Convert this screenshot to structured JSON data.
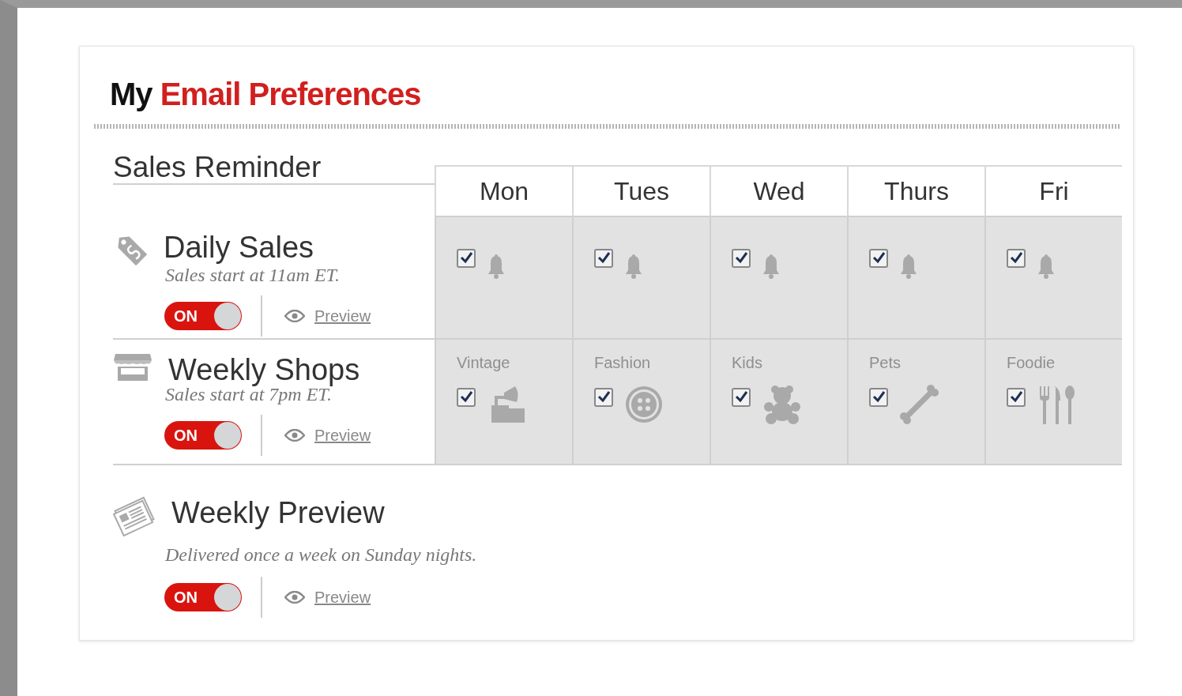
{
  "title": {
    "prefix": "My",
    "highlight": "Email Preferences"
  },
  "section_title": "Sales Reminder",
  "days": [
    {
      "label": "Mon"
    },
    {
      "label": "Tues"
    },
    {
      "label": "Wed"
    },
    {
      "label": "Thurs"
    },
    {
      "label": "Fri"
    }
  ],
  "reminders": [
    {
      "kind": "tag",
      "name": "Daily Sales",
      "note": "Sales start at 11am ET.",
      "toggle": {
        "label": "ON",
        "on": true
      },
      "preview": "Preview",
      "cells": [
        {
          "checked": true,
          "kind": "bell"
        },
        {
          "checked": true,
          "kind": "bell"
        },
        {
          "checked": true,
          "kind": "bell"
        },
        {
          "checked": true,
          "kind": "bell"
        },
        {
          "checked": true,
          "kind": "bell"
        }
      ]
    },
    {
      "kind": "store",
      "name": "Weekly Shops",
      "note": "Sales start at 7pm ET.",
      "toggle": {
        "label": "ON",
        "on": true
      },
      "preview": "Preview",
      "cells": [
        {
          "category": "Vintage",
          "checked": true,
          "kind": "phonograph"
        },
        {
          "category": "Fashion",
          "checked": true,
          "kind": "button"
        },
        {
          "category": "Kids",
          "checked": true,
          "kind": "bear"
        },
        {
          "category": "Pets",
          "checked": true,
          "kind": "bone"
        },
        {
          "category": "Foodie",
          "checked": true,
          "kind": "utensils"
        }
      ]
    }
  ],
  "weekly_preview": {
    "kind": "newspaper",
    "name": "Weekly Preview",
    "note": "Delivered once a week on Sunday nights.",
    "toggle": {
      "label": "ON",
      "on": true
    },
    "preview": "Preview"
  }
}
